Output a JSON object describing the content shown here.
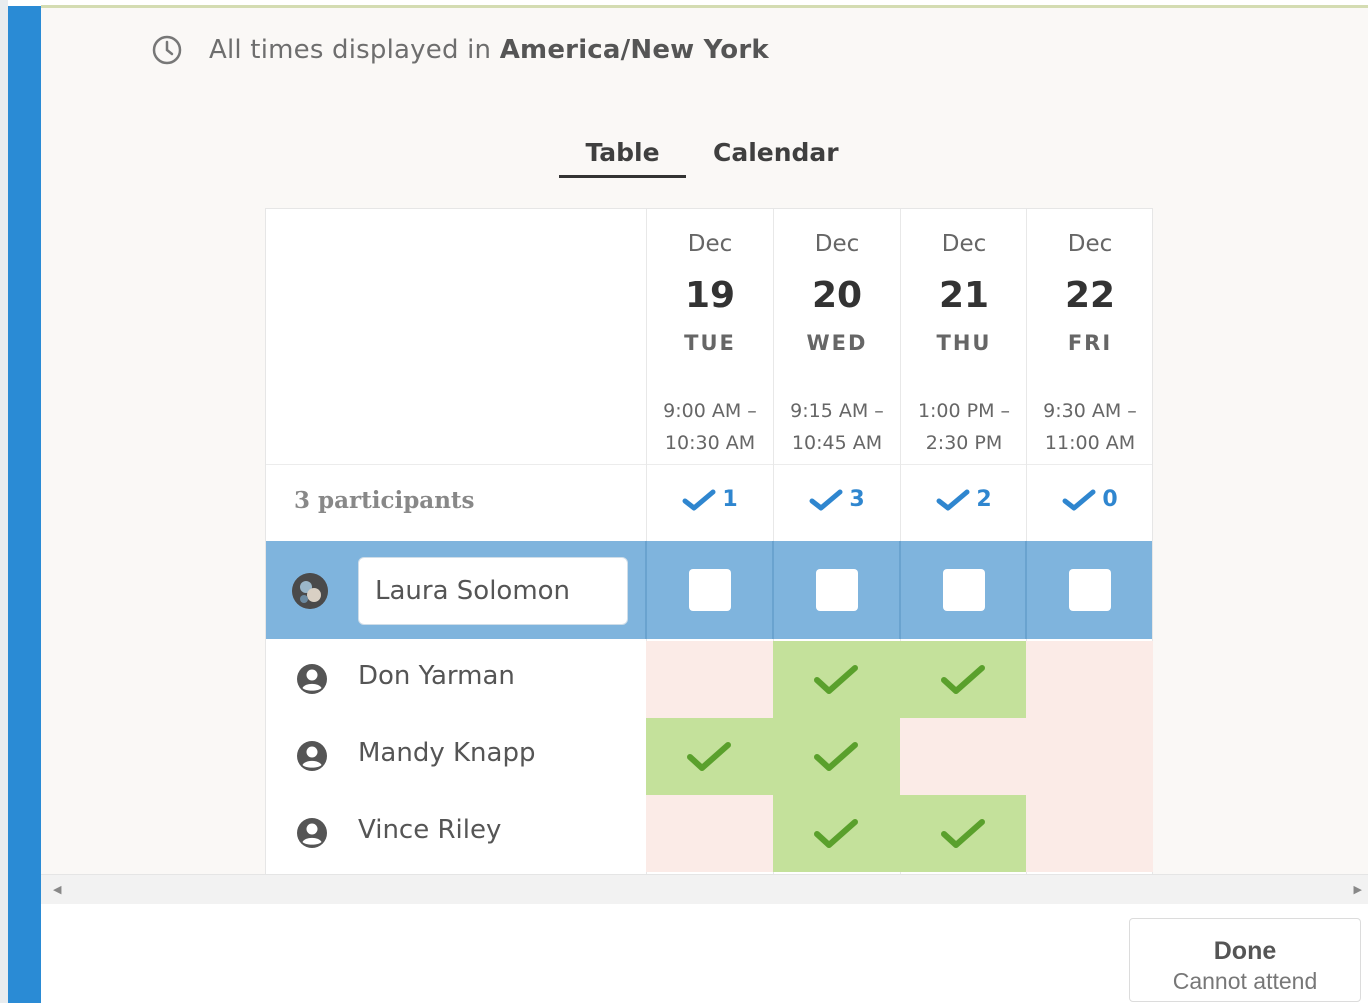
{
  "timezone": {
    "prefix": "All times displayed in",
    "zone": "America/New York"
  },
  "tabs": [
    {
      "label": "Table",
      "active": true
    },
    {
      "label": "Calendar",
      "active": false
    }
  ],
  "dates": [
    {
      "month": "Dec",
      "day": "19",
      "weekday": "TUE",
      "time_start": "9:00 AM –",
      "time_end": "10:30 AM",
      "count": "1"
    },
    {
      "month": "Dec",
      "day": "20",
      "weekday": "WED",
      "time_start": "9:15 AM –",
      "time_end": "10:45 AM",
      "count": "3"
    },
    {
      "month": "Dec",
      "day": "21",
      "weekday": "THU",
      "time_start": "1:00 PM –",
      "time_end": "2:30 PM",
      "count": "2"
    },
    {
      "month": "Dec",
      "day": "22",
      "weekday": "FRI",
      "time_start": "9:30 AM –",
      "time_end": "11:00 AM",
      "count": "0"
    }
  ],
  "participants_label": "3 participants",
  "self": {
    "name": "Laura Solomon"
  },
  "participants": [
    {
      "name": "Don Yarman",
      "availability": [
        false,
        true,
        true,
        false
      ]
    },
    {
      "name": "Mandy Knapp",
      "availability": [
        true,
        true,
        false,
        false
      ]
    },
    {
      "name": "Vince Riley",
      "availability": [
        false,
        true,
        true,
        false
      ]
    }
  ],
  "footer": {
    "done_label": "Done",
    "done_sub": "Cannot attend"
  },
  "colors": {
    "accent": "#2a8bd5",
    "self_row": "#7fb4dd",
    "available": "#c4e19b",
    "unavailable": "#fbebe7",
    "check_green": "#5aa02c",
    "count_blue": "#2f86cf"
  }
}
